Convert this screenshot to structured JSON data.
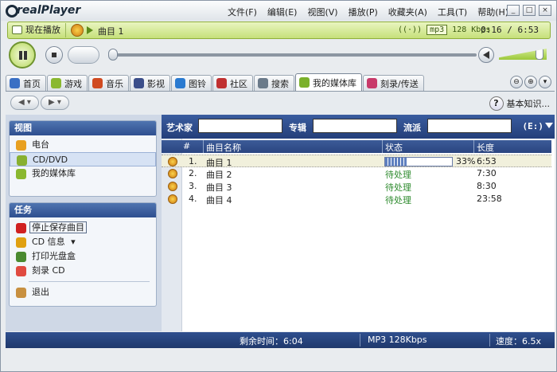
{
  "app": {
    "logo_text": "realPlayer"
  },
  "menu": [
    "文件(F)",
    "编辑(E)",
    "视图(V)",
    "播放(P)",
    "收藏夹(A)",
    "工具(T)",
    "帮助(H)"
  ],
  "window_buttons": [
    "minimize",
    "maximize",
    "close"
  ],
  "now_playing": {
    "button_label": "现在播放",
    "title": "曲目 1",
    "format": "mp3",
    "bitrate": "128 Kbps",
    "time": "0:16 / 6:53"
  },
  "tabs": [
    {
      "label": "首页",
      "icon": "home-icon",
      "color": "#3a6fc4"
    },
    {
      "label": "游戏",
      "icon": "game-icon",
      "color": "#8ab830"
    },
    {
      "label": "音乐",
      "icon": "music-icon",
      "color": "#d04a20"
    },
    {
      "label": "影视",
      "icon": "movie-icon",
      "color": "#3b4e8a"
    },
    {
      "label": "图铃",
      "icon": "ringtone-icon",
      "color": "#2a7ad0"
    },
    {
      "label": "社区",
      "icon": "community-icon",
      "color": "#c03030"
    },
    {
      "label": "搜索",
      "icon": "search-icon",
      "color": "#6a7a8a"
    },
    {
      "label": "我的媒体库",
      "icon": "media-library-icon",
      "color": "#7ab02a"
    },
    {
      "label": "刻录/传送",
      "icon": "burn-icon",
      "color": "#c83a6a"
    }
  ],
  "help_label": "基本知识...",
  "views_panel": {
    "header": "视图",
    "items": [
      {
        "label": "电台",
        "icon": "radio-icon",
        "color": "#e8a020"
      },
      {
        "label": "CD/DVD",
        "icon": "cd-icon",
        "color": "#88b030"
      },
      {
        "label": "我的媒体库",
        "icon": "media-library-icon",
        "color": "#8ab830"
      }
    ]
  },
  "tasks_panel": {
    "header": "任务",
    "items": [
      {
        "label": "停止保存曲目",
        "icon": "stop-save-icon",
        "color": "#d02020"
      },
      {
        "label": "CD 信息",
        "icon": "cd-info-icon",
        "color": "#e0a010",
        "has_dropdown": true
      },
      {
        "label": "打印光盘盒",
        "icon": "print-icon",
        "color": "#4a8a30"
      },
      {
        "label": "刻录 CD",
        "icon": "burn-cd-icon",
        "color": "#e04a40"
      },
      {
        "label": "退出",
        "icon": "exit-icon",
        "color": "#c89040"
      }
    ]
  },
  "filters": {
    "artist_label": "艺术家",
    "album_label": "专辑",
    "genre_label": "流派",
    "drive": "(E:)"
  },
  "table": {
    "columns": [
      "#",
      "曲目名称",
      "状态",
      "长度"
    ],
    "rows": [
      {
        "num": "1.",
        "name": "曲目 1",
        "status": "",
        "progress_text": "33%",
        "progress": 0.33,
        "length": "6:53",
        "selected": true
      },
      {
        "num": "2.",
        "name": "曲目 2",
        "status": "待处理",
        "length": "7:30"
      },
      {
        "num": "3.",
        "name": "曲目 3",
        "status": "待处理",
        "length": "8:30"
      },
      {
        "num": "4.",
        "name": "曲目 4",
        "status": "待处理",
        "length": "23:58"
      }
    ]
  },
  "statusbar": {
    "remaining": "剩余时间：6:04",
    "format": "MP3 128Kbps",
    "speed": "速度：6.5x"
  },
  "colors": {
    "accent_green": "#c6e07a",
    "header_blue": "#2e4f8f",
    "status_green": "#2e8b2e"
  }
}
